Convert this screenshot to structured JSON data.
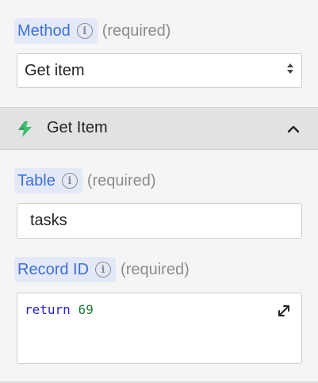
{
  "method_field": {
    "label": "Method",
    "required_text": "(required)",
    "selected_value": "Get item"
  },
  "section": {
    "title": "Get Item",
    "icon": "bolt-icon",
    "icon_color": "#3dbf72",
    "expanded": true
  },
  "table_field": {
    "label": "Table",
    "required_text": "(required)",
    "value": "tasks"
  },
  "record_id_field": {
    "label": "Record ID",
    "required_text": "(required)",
    "code_keyword": "return",
    "code_value": "69"
  },
  "colors": {
    "label_accent": "#3f6fd8",
    "label_bg": "#e3e9f7",
    "muted_text": "#8c8c8c",
    "code_keyword": "#2424c8",
    "code_number": "#1f7a3a"
  }
}
